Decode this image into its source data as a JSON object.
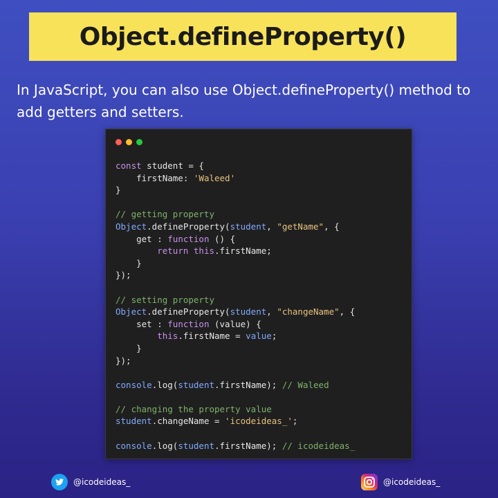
{
  "title": "Object.defineProperty()",
  "intro": "In JavaScript, you can also use Object.defineProperty() method to add getters and setters.",
  "colors": {
    "banner": "#f8e25a",
    "keyword": "#c792ea",
    "string": "#e8c37f",
    "comment": "#7fb26b",
    "property": "#82aaff",
    "dot_red": "#ff5f56",
    "dot_yellow": "#ffbd2e",
    "dot_green": "#27c93f"
  },
  "window_controls": [
    "close-dot",
    "minimize-dot",
    "maximize-dot"
  ],
  "code_lines": [
    [
      {
        "t": "const",
        "c": "keyword"
      },
      {
        "t": " student = {"
      }
    ],
    [
      {
        "t": "    firstName: "
      },
      {
        "t": "'Waleed'",
        "c": "string"
      }
    ],
    [
      {
        "t": "}"
      }
    ],
    [],
    [
      {
        "t": "// getting property",
        "c": "comment"
      }
    ],
    [
      {
        "t": "Object",
        "c": "prop"
      },
      {
        "t": ".defineProperty("
      },
      {
        "t": "student",
        "c": "prop"
      },
      {
        "t": ", "
      },
      {
        "t": "\"getName\"",
        "c": "string"
      },
      {
        "t": ", {"
      }
    ],
    [
      {
        "t": "    get : "
      },
      {
        "t": "function",
        "c": "keyword"
      },
      {
        "t": " () {"
      }
    ],
    [
      {
        "t": "        "
      },
      {
        "t": "return",
        "c": "keyword"
      },
      {
        "t": " "
      },
      {
        "t": "this",
        "c": "keyword"
      },
      {
        "t": ".firstName;"
      }
    ],
    [
      {
        "t": "    }"
      }
    ],
    [
      {
        "t": "});"
      }
    ],
    [],
    [
      {
        "t": "// setting property",
        "c": "comment"
      }
    ],
    [
      {
        "t": "Object",
        "c": "prop"
      },
      {
        "t": ".defineProperty("
      },
      {
        "t": "student",
        "c": "prop"
      },
      {
        "t": ", "
      },
      {
        "t": "\"changeName\"",
        "c": "string"
      },
      {
        "t": ", {"
      }
    ],
    [
      {
        "t": "    set : "
      },
      {
        "t": "function",
        "c": "keyword"
      },
      {
        "t": " (value) {"
      }
    ],
    [
      {
        "t": "        "
      },
      {
        "t": "this",
        "c": "keyword"
      },
      {
        "t": ".firstName = "
      },
      {
        "t": "value",
        "c": "prop"
      },
      {
        "t": ";"
      }
    ],
    [
      {
        "t": "    }"
      }
    ],
    [
      {
        "t": "});"
      }
    ],
    [],
    [
      {
        "t": "console",
        "c": "prop"
      },
      {
        "t": ".log("
      },
      {
        "t": "student",
        "c": "prop"
      },
      {
        "t": ".firstName); "
      },
      {
        "t": "// Waleed",
        "c": "comment"
      }
    ],
    [],
    [
      {
        "t": "// changing the property value",
        "c": "comment"
      }
    ],
    [
      {
        "t": "student",
        "c": "prop"
      },
      {
        "t": ".changeName = "
      },
      {
        "t": "'icodeideas_'",
        "c": "string"
      },
      {
        "t": ";"
      }
    ],
    [],
    [
      {
        "t": "console",
        "c": "prop"
      },
      {
        "t": ".log("
      },
      {
        "t": "student",
        "c": "prop"
      },
      {
        "t": ".firstName); "
      },
      {
        "t": "// icodeideas_",
        "c": "comment"
      }
    ]
  ],
  "footer": {
    "twitter_icon": "twitter-icon",
    "twitter_handle": "@icodeideas_",
    "instagram_icon": "instagram-icon",
    "instagram_handle": "@icodeideas_"
  }
}
